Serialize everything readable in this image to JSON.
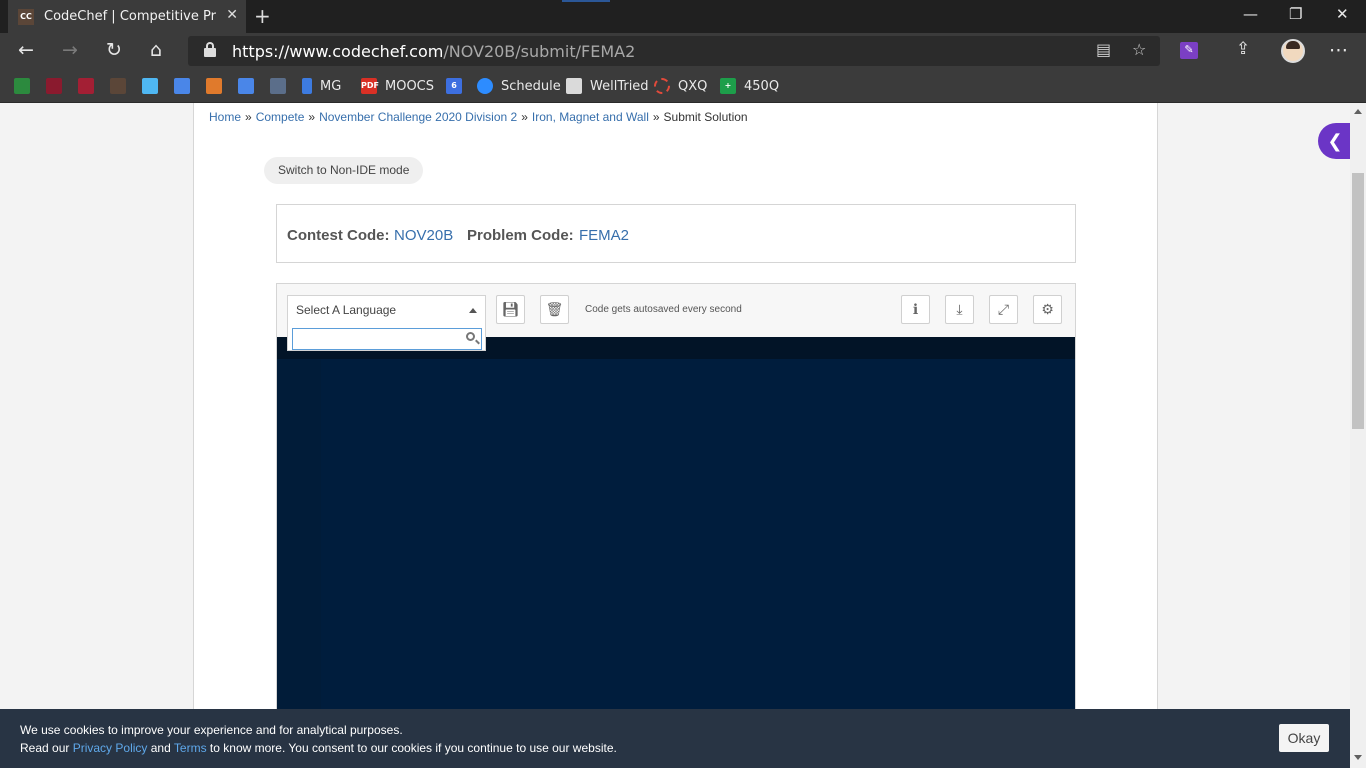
{
  "browser": {
    "tab_title": "CodeChef | Competitive Programming",
    "tab_favicon": "CC",
    "url_host": "https://www.codechef.com",
    "url_path": "/NOV20B/submit/FEMA2",
    "bookmarks": [
      {
        "label": "",
        "icon": "gtk-icon",
        "color": "#2c8a3e"
      },
      {
        "label": "",
        "icon": "mit-piano-icon",
        "color": "#8a1a2e"
      },
      {
        "label": "",
        "icon": "mit-ocw-icon",
        "color": "#a31f34"
      },
      {
        "label": "",
        "icon": "codechef-icon",
        "color": "#5b4638"
      },
      {
        "label": "",
        "icon": "flutter-icon",
        "color": "#4fb7f2"
      },
      {
        "label": "",
        "icon": "docs-icon",
        "color": "#4a86e8"
      },
      {
        "label": "",
        "icon": "python-icon",
        "color": "#e07a2c"
      },
      {
        "label": "",
        "icon": "docs-icon-2",
        "color": "#4a86e8"
      },
      {
        "label": "",
        "icon": "image-icon",
        "color": "#5b6e8a"
      },
      {
        "label": "MG",
        "icon": "bookmark-blue-icon",
        "color": "#3d7be0"
      },
      {
        "label": "MOOCS",
        "icon": "pdf-icon",
        "color": "#d93025"
      },
      {
        "label": "",
        "icon": "calendar-icon",
        "color": "#3d6fe0"
      },
      {
        "label": "Schedule",
        "icon": "zoom-icon",
        "color": "#2d8cff"
      },
      {
        "label": "WellTried",
        "icon": "notion-icon",
        "color": "#dadada"
      },
      {
        "label": "QXQ",
        "icon": "circle-dashed-icon",
        "color": "#e24a3b"
      },
      {
        "label": "450Q",
        "icon": "plus-sheet-icon",
        "color": "#1d9e4a"
      }
    ]
  },
  "breadcrumb": {
    "home": "Home",
    "compete": "Compete",
    "contest": "November Challenge 2020 Division 2",
    "problem": "Iron, Magnet and Wall",
    "current": "Submit Solution",
    "separator": "»"
  },
  "switch_mode": "Switch to Non-IDE mode",
  "codes": {
    "contest_label": "Contest Code:",
    "contest_value": "NOV20B",
    "problem_label": "Problem Code:",
    "problem_value": "FEMA2"
  },
  "ide": {
    "language_placeholder": "Select A Language",
    "autosave_note": "Code gets autosaved every second",
    "search_value": ""
  },
  "cookie": {
    "line1": "We use cookies to improve your experience and for analytical purposes.",
    "read_our": "Read our",
    "privacy": "Privacy Policy",
    "and": "and",
    "terms": "Terms",
    "rest": "to know more. You consent to our cookies if you continue to use our website.",
    "okay": "Okay"
  }
}
